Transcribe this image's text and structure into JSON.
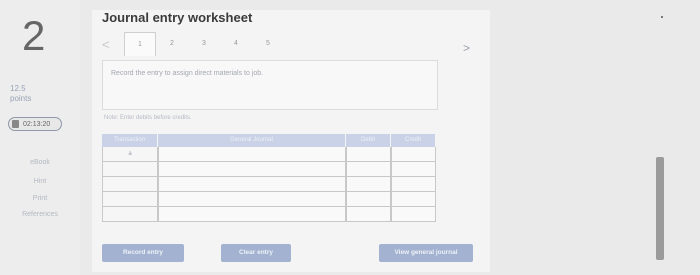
{
  "question": {
    "number": "2",
    "points": "12.5\npoints",
    "timer": "02:13:20"
  },
  "sidebar": {
    "links": [
      "eBook",
      "Hint",
      "Print",
      "References"
    ]
  },
  "worksheet": {
    "title": "Journal entry worksheet",
    "prev_symbol": "<",
    "next_symbol": ">",
    "tabs": [
      "1",
      "2",
      "3",
      "4",
      "5"
    ],
    "prompt": "Record the entry to assign direct materials to job.",
    "note": "Note: Enter debits before credits.",
    "columns": [
      "Transaction",
      "General Journal",
      "Debit",
      "Credit"
    ],
    "rows": [
      {
        "transaction": "a"
      },
      {
        "transaction": ""
      },
      {
        "transaction": ""
      },
      {
        "transaction": ""
      },
      {
        "transaction": ""
      }
    ],
    "buttons": {
      "record": "Record entry",
      "clear": "Clear entry",
      "view": "View general journal"
    }
  }
}
